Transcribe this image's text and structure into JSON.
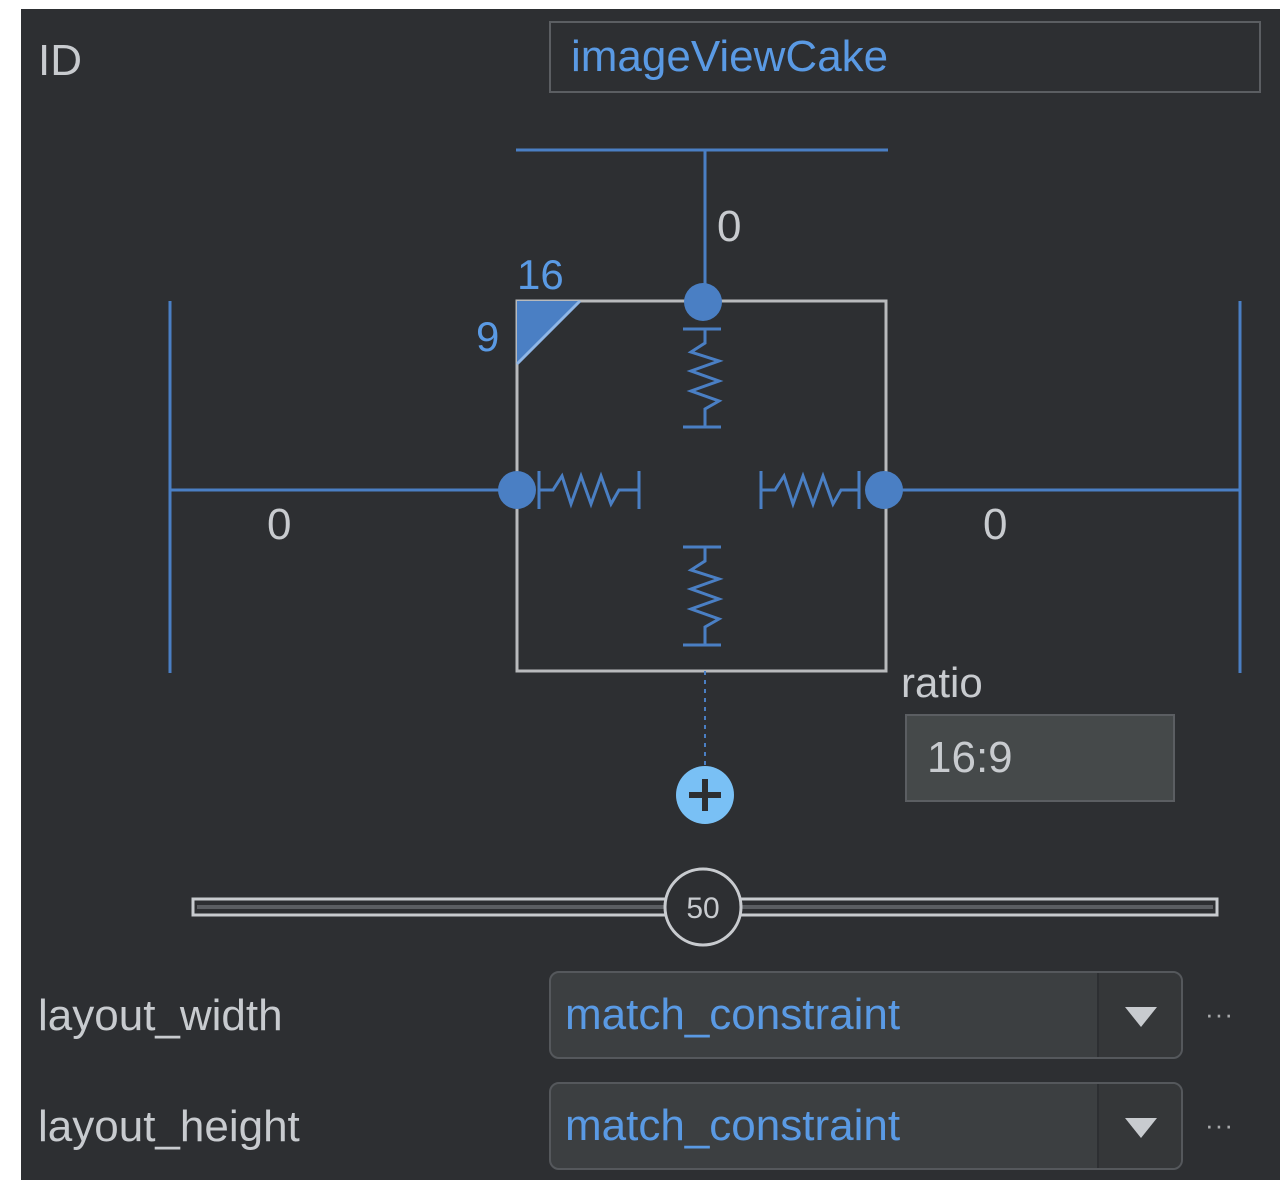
{
  "id_row": {
    "label": "ID",
    "value": "imageViewCake"
  },
  "constraint_widget": {
    "top_margin": "0",
    "left_margin": "0",
    "right_margin": "0",
    "ratio_width_label": "16",
    "ratio_height_label": "9",
    "ratio_label": "ratio",
    "ratio_value": "16:9",
    "bias_value": "50",
    "bias_percent": 50
  },
  "layout_width": {
    "label": "layout_width",
    "value": "match_constraint",
    "more": "···"
  },
  "layout_height": {
    "label": "layout_height",
    "value": "match_constraint",
    "more": "···"
  },
  "colors": {
    "background": "#2d2f32",
    "accent": "#4a7fc4",
    "accent_text": "#5a9ae4",
    "plus_icon": "#79c0f5",
    "text": "#c8cbcf"
  },
  "icons": {
    "add_constraint": "plus-circle-icon",
    "dropdown": "triangle-down-icon",
    "ratio_toggle": "ratio-triangle-icon"
  }
}
